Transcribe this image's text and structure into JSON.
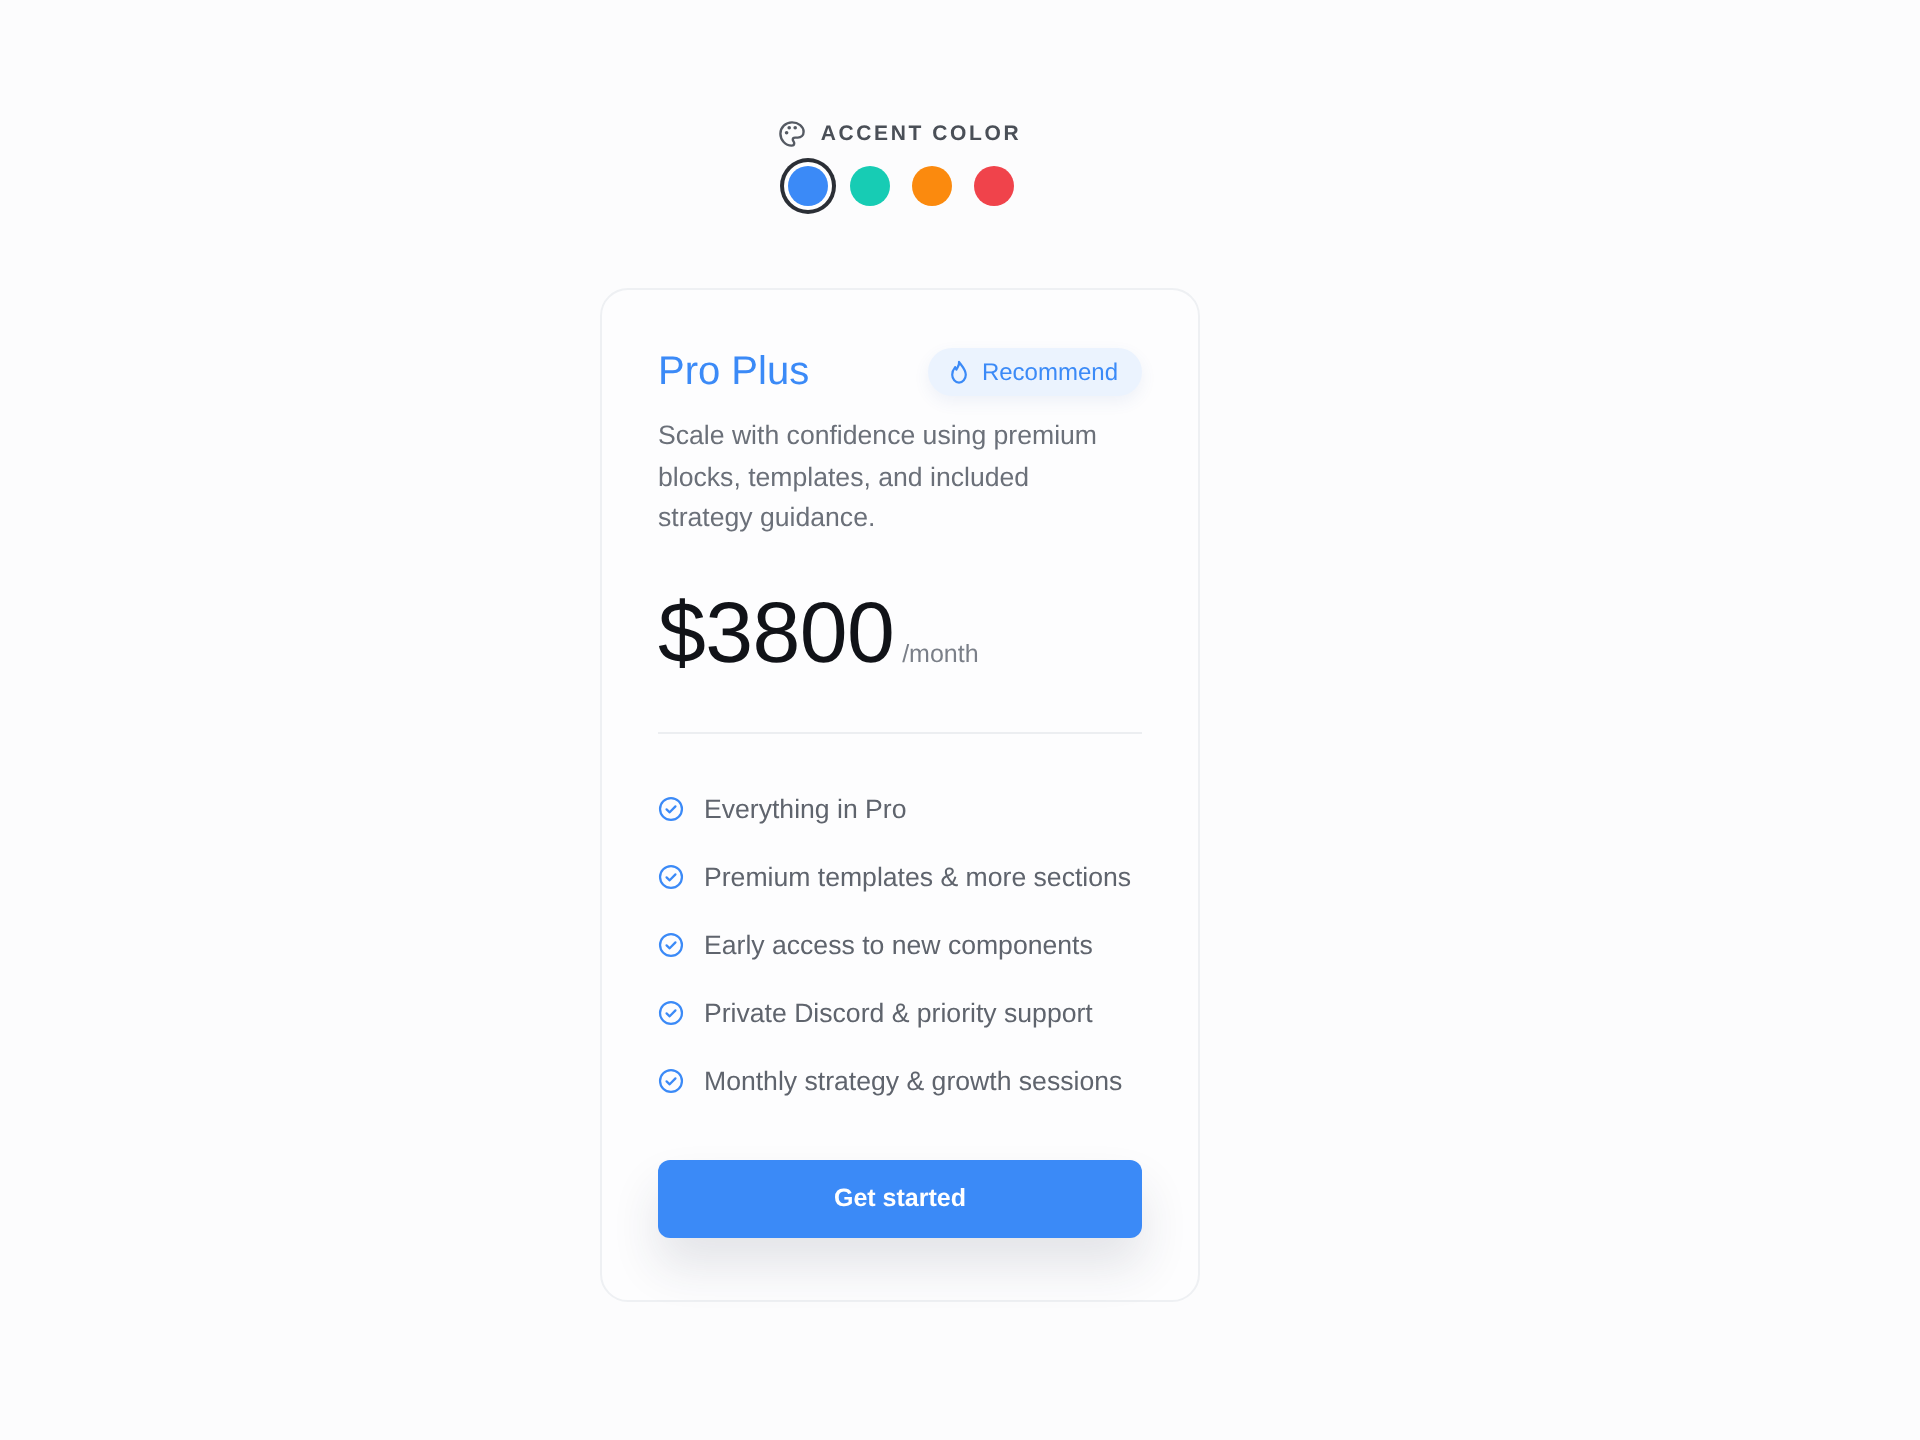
{
  "accent_picker": {
    "label": "ACCENT COLOR",
    "swatches": [
      {
        "color": "#3b8af7",
        "selected": true
      },
      {
        "color": "#17ccb4",
        "selected": false
      },
      {
        "color": "#fb8a0e",
        "selected": false
      },
      {
        "color": "#f0434b",
        "selected": false
      }
    ]
  },
  "plan": {
    "name": "Pro Plus",
    "badge": "Recommend",
    "description": "Scale with confidence using premium blocks, templates, and included strategy guidance.",
    "price": "$3800",
    "period": "/month",
    "features": [
      "Everything in Pro",
      "Premium templates & more sections",
      "Early access to new components",
      "Private Discord & priority support",
      "Monthly strategy & growth sessions"
    ],
    "button": "Get started"
  }
}
